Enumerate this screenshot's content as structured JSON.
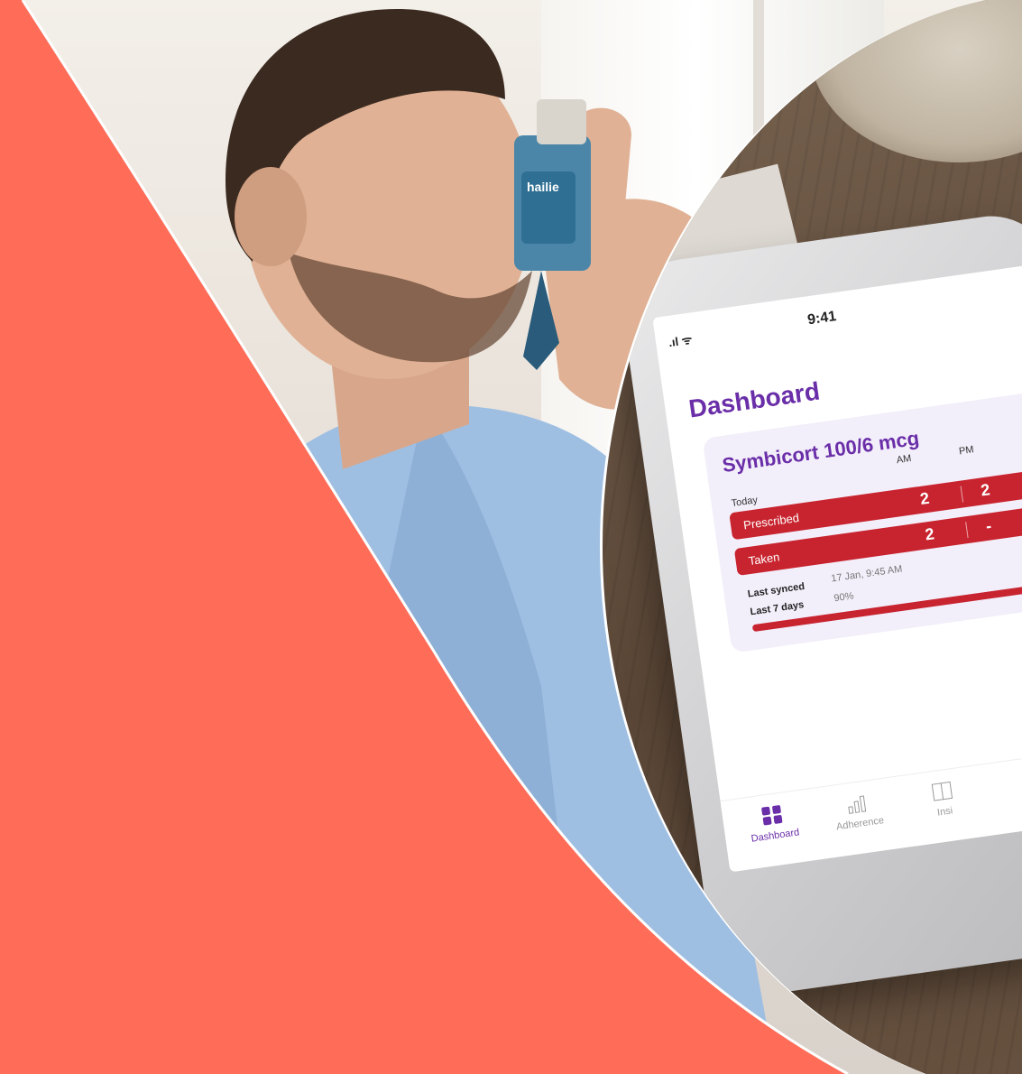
{
  "colors": {
    "coral": "#ff6d59",
    "purple": "#6a2ea8",
    "red": "#c8242f"
  },
  "inhaler": {
    "brand": "hailie"
  },
  "phone": {
    "status_time": "9:41",
    "title": "Dashboard",
    "card": {
      "medication": "Symbicort 100/6 mcg",
      "col_am": "AM",
      "col_pm": "PM",
      "today_label": "Today",
      "prescribed_label": "Prescribed",
      "prescribed_am": "2",
      "prescribed_pm": "2",
      "taken_label": "Taken",
      "taken_am": "2",
      "taken_pm": "-",
      "last_synced_label": "Last synced",
      "last_synced_value": "17 Jan, 9:45 AM",
      "last7_label": "Last 7 days",
      "last7_value": "90%",
      "last7_fraction": 0.9
    },
    "tabs": [
      {
        "label": "Dashboard",
        "icon": "grid-icon"
      },
      {
        "label": "Adherence",
        "icon": "bar-chart-icon"
      },
      {
        "label": "Insi",
        "icon": "calendar-icon"
      }
    ]
  }
}
